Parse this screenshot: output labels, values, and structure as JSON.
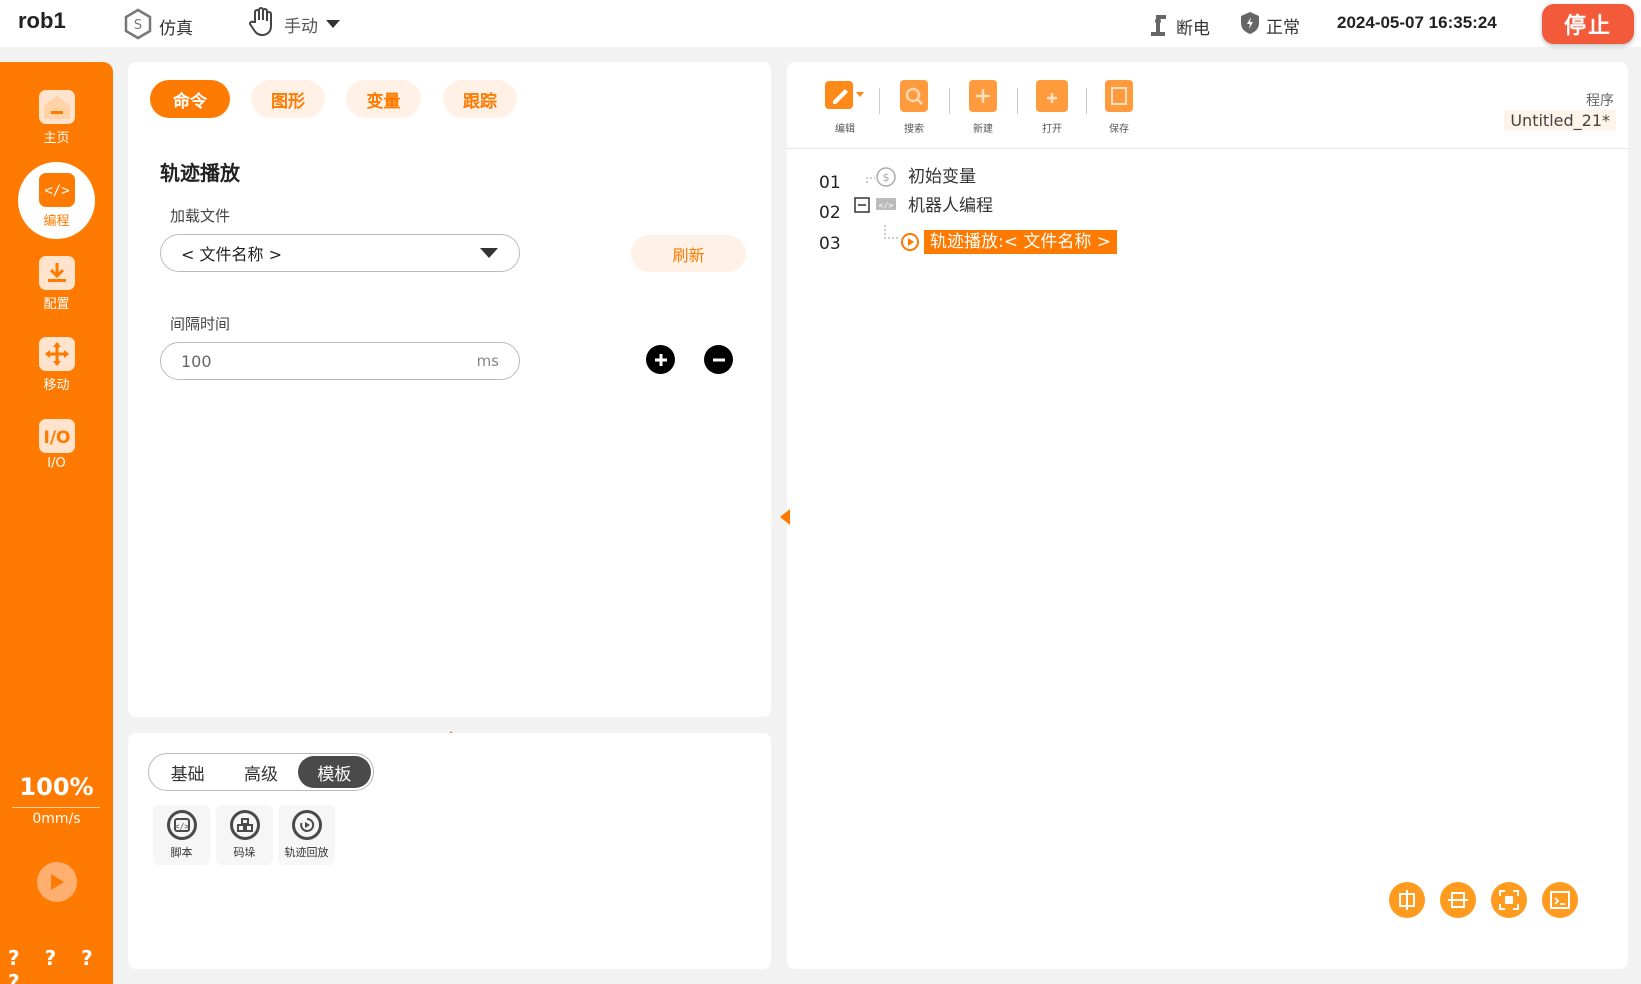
{
  "topbar": {
    "robot_name": "rob1",
    "mode": "仿真",
    "control": "手动",
    "power_status": "断电",
    "safety_status": "正常",
    "datetime": "2024-05-07 16:35:24",
    "stop_label": "停止"
  },
  "sidebar": {
    "items": [
      {
        "label": "主页",
        "icon": "home-icon"
      },
      {
        "label": "编程",
        "icon": "code-icon"
      },
      {
        "label": "配置",
        "icon": "download-icon"
      },
      {
        "label": "移动",
        "icon": "move-icon"
      },
      {
        "label": "I/O",
        "icon": "io-icon"
      }
    ],
    "speed_percent": "100%",
    "speed_value": "0mm/s",
    "footer": "? ? ? ?"
  },
  "command_panel": {
    "tabs": [
      {
        "label": "命令",
        "active": true
      },
      {
        "label": "图形",
        "active": false
      },
      {
        "label": "变量",
        "active": false
      },
      {
        "label": "跟踪",
        "active": false
      }
    ],
    "section_title": "轨迹播放",
    "load_file_label": "加载文件",
    "file_select_value": "< 文件名称 >",
    "refresh_label": "刷新",
    "interval_label": "间隔时间",
    "interval_value": "100",
    "interval_unit": "ms"
  },
  "template_panel": {
    "segments": [
      {
        "label": "基础",
        "active": false
      },
      {
        "label": "高级",
        "active": false
      },
      {
        "label": "模板",
        "active": true
      }
    ],
    "buttons": [
      {
        "label": "脚本",
        "icon": "script-icon"
      },
      {
        "label": "码垛",
        "icon": "palletize-icon"
      },
      {
        "label": "轨迹回放",
        "icon": "trajectory-replay-icon"
      }
    ]
  },
  "program_panel": {
    "toolbar": [
      {
        "label": "编辑",
        "icon": "edit-icon"
      },
      {
        "label": "搜索",
        "icon": "search-icon"
      },
      {
        "label": "新建",
        "icon": "new-file-icon"
      },
      {
        "label": "打开",
        "icon": "open-folder-icon"
      },
      {
        "label": "保存",
        "icon": "save-icon"
      }
    ],
    "program_label": "程序",
    "program_name": "Untitled_21*",
    "lines": [
      {
        "num": "01",
        "text": "初始变量"
      },
      {
        "num": "02",
        "text": "机器人编程"
      },
      {
        "num": "03",
        "text": "轨迹播放:< 文件名称 >"
      }
    ],
    "colors": {
      "accent": "#ff7a00",
      "stop": "#f35a3a"
    }
  }
}
